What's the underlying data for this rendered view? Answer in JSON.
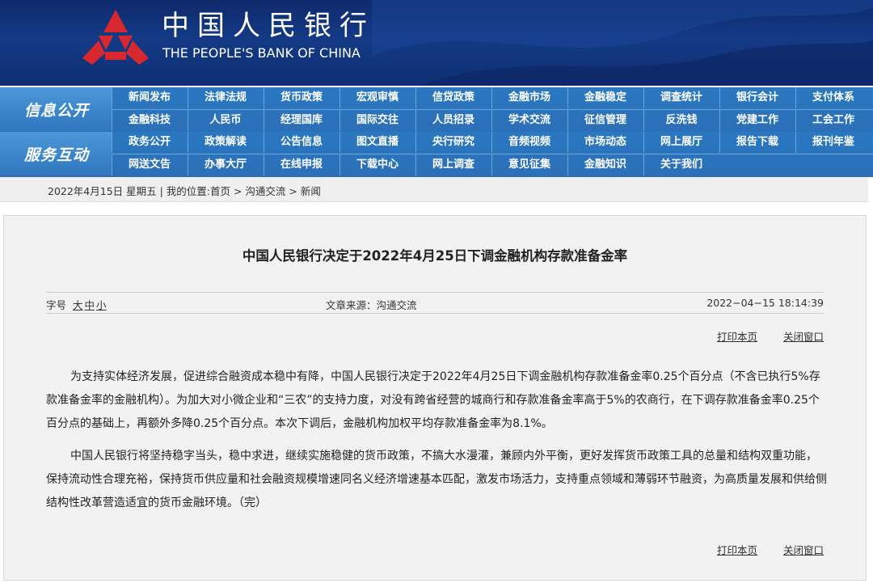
{
  "banner": {
    "title_cn": "中国人民银行",
    "title_en": "THE PEOPLE'S BANK OF CHINA",
    "logo_icon": "pboc-logo-icon",
    "logo_color": "#d7272f"
  },
  "nav": {
    "sections": [
      {
        "label": "信息公开",
        "top": [
          "新闻发布",
          "法律法规",
          "货币政策",
          "宏观审慎",
          "信贷政策",
          "金融市场",
          "金融稳定",
          "调查统计",
          "银行会计",
          "支付体系"
        ],
        "bottom": [
          "金融科技",
          "人民币",
          "经理国库",
          "国际交往",
          "人员招录",
          "学术交流",
          "征信管理",
          "反洗钱",
          "党建工作",
          "工会工作"
        ]
      },
      {
        "label": "服务互动",
        "top": [
          "政务公开",
          "政策解读",
          "公告信息",
          "图文直播",
          "央行研究",
          "音频视频",
          "市场动态",
          "网上展厅",
          "报告下载",
          "报刊年鉴"
        ],
        "bottom": [
          "网送文告",
          "办事大厅",
          "在线申报",
          "下载中心",
          "网上调查",
          "意见征集",
          "金融知识",
          "关于我们"
        ]
      }
    ]
  },
  "breadcrumb": "2022年4月15日 星期五 | 我的位置:首页 > 沟通交流 > 新闻",
  "article": {
    "title": "中国人民银行决定于2022年4月25日下调金融机构存款准备金率",
    "font_size_label": "字号",
    "font_sizes": [
      "大",
      "中",
      "小"
    ],
    "source": "文章来源：沟通交流",
    "datetime": "2022−04−15 18:14:39",
    "print_label": "打印本页",
    "close_label": "关闭窗口",
    "paragraphs": [
      "为支持实体经济发展，促进综合融资成本稳中有降，中国人民银行决定于2022年4月25日下调金融机构存款准备金率0.25个百分点（不含已执行5%存款准备金率的金融机构）。为加大对小微企业和“三农”的支持力度，对没有跨省经营的城商行和存款准备金率高于5%的农商行，在下调存款准备金率0.25个百分点的基础上，再额外多降0.25个百分点。本次下调后，金融机构加权平均存款准备金率为8.1%。",
      "中国人民银行将坚持稳字当头，稳中求进，继续实施稳健的货币政策，不搞大水漫灌，兼顾内外平衡，更好发挥货币政策工具的总量和结构双重功能，保持流动性合理充裕，保持货币供应量和社会融资规模增速同名义经济增速基本匹配，激发市场活力，支持重点领域和薄弱环节融资，为高质量发展和供给侧结构性改革营造适宜的货币金融环境。（完）"
    ]
  }
}
